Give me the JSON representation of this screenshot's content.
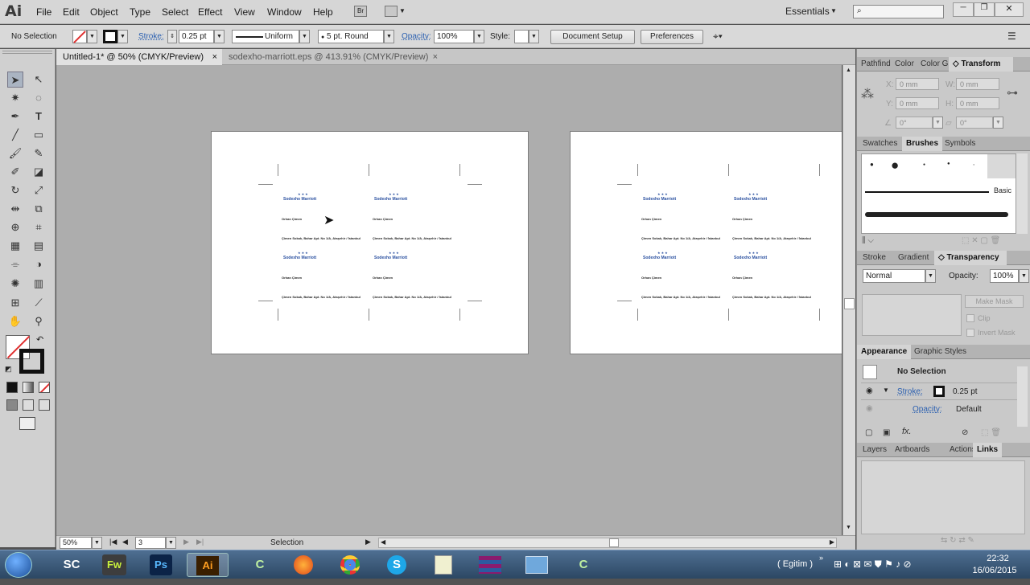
{
  "app": {
    "logo": "Ai",
    "workspace": "Essentials"
  },
  "menu": [
    "File",
    "Edit",
    "Object",
    "Type",
    "Select",
    "Effect",
    "View",
    "Window",
    "Help"
  ],
  "control": {
    "selection": "No Selection",
    "stroke_label": "Stroke:",
    "stroke_value": "0.25 pt",
    "profile": "Uniform",
    "brush": "5 pt. Round",
    "opacity_label": "Opacity:",
    "opacity_value": "100%",
    "style_label": "Style:",
    "document_setup": "Document Setup",
    "preferences": "Preferences"
  },
  "tabs": [
    {
      "label": "Untitled-1* @ 50% (CMYK/Preview)",
      "active": true
    },
    {
      "label": "sodexho-marriott.eps @ 413.91% (CMYK/Preview)",
      "active": false
    }
  ],
  "card": {
    "brand": "Sodexho Marriott",
    "name": "Orhan Çimen",
    "address": "Çimen Sokak, Bahar Apt. No 1/A, Ataşehir / İstanbul"
  },
  "status": {
    "zoom": "50%",
    "page": "3",
    "tool": "Selection"
  },
  "panels": {
    "transform_tabs": [
      "Pathfind",
      "Color",
      "Color G",
      "Transform"
    ],
    "transform": {
      "x_label": "X:",
      "y_label": "Y:",
      "w_label": "W:",
      "h_label": "H:",
      "x": "0 mm",
      "y": "0 mm",
      "w": "0 mm",
      "h": "0 mm",
      "angle": "0°",
      "shear": "0°"
    },
    "swatch_tabs": [
      "Swatches",
      "Brushes",
      "Symbols"
    ],
    "brush_basic": "Basic",
    "transparency_tabs": [
      "Stroke",
      "Gradient",
      "Transparency"
    ],
    "blend_mode": "Normal",
    "opacity_label": "Opacity:",
    "opacity": "100%",
    "make_mask": "Make Mask",
    "clip": "Clip",
    "invert_mask": "Invert Mask",
    "appearance_tabs": [
      "Appearance",
      "Graphic Styles"
    ],
    "appearance_title": "No Selection",
    "appearance_stroke_label": "Stroke:",
    "appearance_stroke_value": "0.25 pt",
    "appearance_opacity_label": "Opacity:",
    "appearance_opacity_value": "Default",
    "layers_tabs": [
      "Layers",
      "Artboards",
      "Actions",
      "Links"
    ]
  },
  "taskbar": {
    "apps": [
      "SC",
      "Fw",
      "Ps",
      "Ai",
      "C",
      "Firefox",
      "Chrome",
      "Skype",
      "Notepad",
      "WinRAR",
      "Control",
      "C"
    ],
    "language": "( Egitim )",
    "time": "22:32",
    "date": "16/06/2015"
  }
}
